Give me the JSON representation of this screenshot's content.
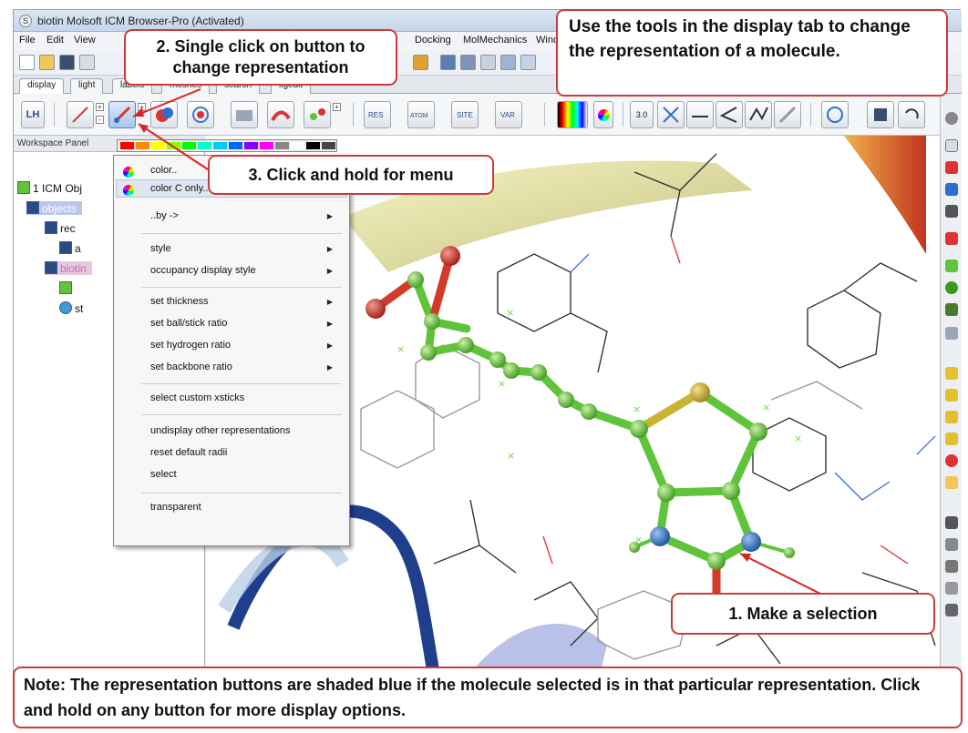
{
  "window": {
    "title": "biotin Molsoft ICM Browser-Pro (Activated)"
  },
  "menubar": {
    "items": [
      "File",
      "Edit",
      "View",
      "Docking",
      "MolMechanics",
      "Windows"
    ]
  },
  "tabs": [
    "display",
    "light",
    "labels",
    "meshes",
    "search",
    "ligedit"
  ],
  "toolbar": {
    "lh_label": "LH",
    "zoom_value": "3.0"
  },
  "workspace": {
    "title": "Workspace Panel",
    "tree": {
      "root": "1 ICM Obj",
      "objects": "objects",
      "rec": "rec",
      "a": "a",
      "biotin": "biotin",
      "st": "st"
    }
  },
  "popup_menu": {
    "items": [
      {
        "label": "color..",
        "icon": "color-wheel-icon"
      },
      {
        "label": "color C only..",
        "icon": "color-wheel-icon"
      },
      {
        "label": "..by ->",
        "submenu": true
      },
      {
        "label": "style",
        "submenu": true
      },
      {
        "label": "occupancy display style",
        "submenu": true
      },
      {
        "label": "set thickness",
        "submenu": true
      },
      {
        "label": "set ball/stick ratio",
        "submenu": true
      },
      {
        "label": "set hydrogen ratio",
        "submenu": true
      },
      {
        "label": "set backbone ratio",
        "submenu": true
      },
      {
        "label": "select custom xsticks"
      },
      {
        "label": "undisplay other representations"
      },
      {
        "label": "reset default radii"
      },
      {
        "label": "select"
      },
      {
        "label": "transparent"
      }
    ],
    "swatch_colors": [
      "#ff0000",
      "#ff8800",
      "#ffff00",
      "#88ff00",
      "#00ff00",
      "#00ffcc",
      "#00ccff",
      "#0066ff",
      "#8800ff",
      "#ff00ff",
      "#888888",
      "#ffffff",
      "#000000",
      "#444444"
    ]
  },
  "callouts": {
    "step2": "2. Single click on button to change representation",
    "step3": "3. Click and hold for menu",
    "step1": "1. Make a selection",
    "display_tab": "Use the tools in the display tab to change the representation of a molecule.",
    "note": "Note: The representation buttons are shaded blue if the molecule selected is in that particular representation. Click and hold on any button for more display options."
  },
  "colors": {
    "callout_border": "#cc3b3b",
    "ligand_green": "#5fc43a",
    "nitrogen_blue": "#2f6fc4",
    "oxygen_red": "#d23a2a",
    "sulfur_yellow": "#c9b332"
  }
}
